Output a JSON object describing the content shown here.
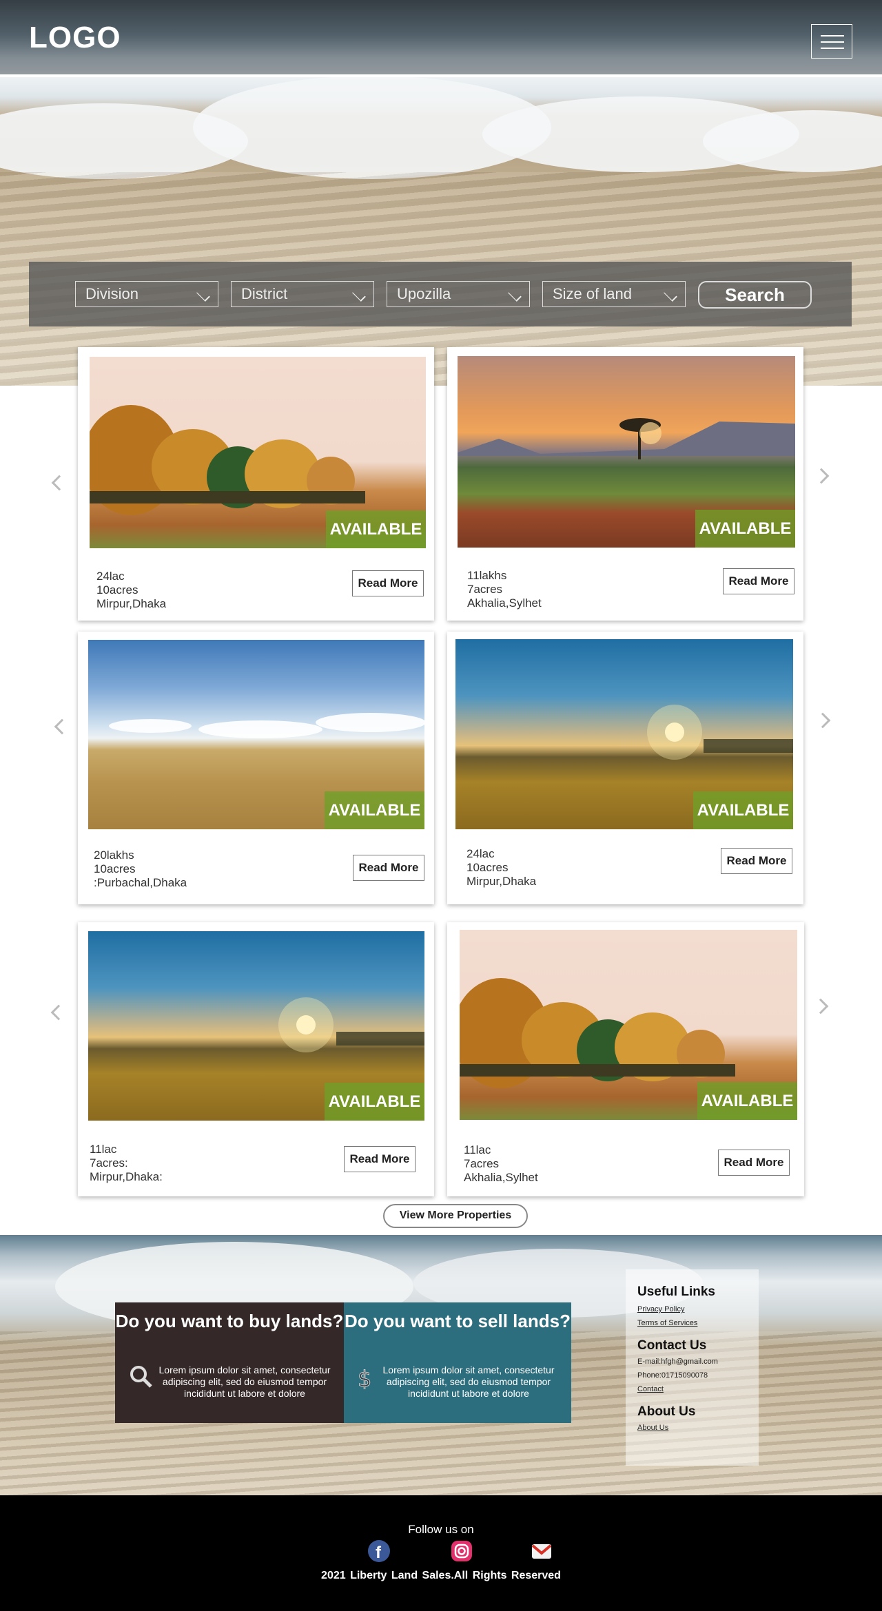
{
  "header": {
    "logo": "LOGO",
    "menu_icon": "hamburger-icon"
  },
  "search": {
    "filters": [
      "Division",
      "District",
      "Upozilla",
      "Size of land"
    ],
    "button": "Search"
  },
  "listings": [
    {
      "price": "24lac",
      "size": "10acres",
      "location": "Mirpur,Dhaka",
      "status": "AVAILABLE",
      "read_more": "Read More"
    },
    {
      "price": "11lakhs",
      "size": "7acres",
      "location": "Akhalia,Sylhet",
      "status": "AVAILABLE",
      "read_more": "Read More"
    },
    {
      "price": "20lakhs",
      "size": "10acres",
      "location": ":Purbachal,Dhaka",
      "status": "AVAILABLE",
      "read_more": "Read More"
    },
    {
      "price": "24lac",
      "size": "10acres",
      "location": "Mirpur,Dhaka",
      "status": "AVAILABLE",
      "read_more": "Read More"
    },
    {
      "price": "11lac",
      "size": "7acres:",
      "location": "Mirpur,Dhaka:",
      "status": "AVAILABLE",
      "read_more": "Read More"
    },
    {
      "price": "11lac",
      "size": "7acres",
      "location": "Akhalia,Sylhet",
      "status": "AVAILABLE",
      "read_more": "Read More"
    }
  ],
  "view_more": "View More Properties",
  "buy": {
    "title": "Do you want to buy lands?",
    "text": "Lorem ipsum dolor sit amet, consectetur adipiscing elit, sed do eiusmod tempor incididunt ut labore et dolore",
    "icon": "magnifier-icon",
    "color": "#352828"
  },
  "sell": {
    "title": "Do you want to sell lands?",
    "text": "Lorem ipsum dolor sit amet, consectetur adipiscing elit, sed do eiusmod tempor incididunt ut labore et dolore",
    "icon": "dollar-icon",
    "color": "#2d6e7e"
  },
  "useful_links": {
    "title": "Useful Links",
    "items": [
      "Privacy Policy",
      "Terms of Services"
    ]
  },
  "contact": {
    "title": "Contact Us",
    "email": "E-mail:hfgh@gmail.com",
    "phone": "Phone:01715090078",
    "link": "Contact"
  },
  "about": {
    "title": "About Us",
    "link": "About Us"
  },
  "footer": {
    "follow": "Follow us on",
    "social": [
      "facebook-icon",
      "instagram-icon",
      "gmail-icon"
    ],
    "copyright": "2021 Liberty Land Sales.All Rights Reserved"
  },
  "colors": {
    "available_badge": "#6ea028",
    "footer_bg": "#000000"
  }
}
